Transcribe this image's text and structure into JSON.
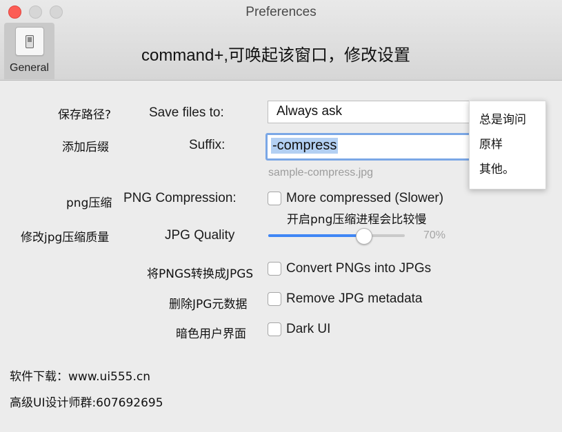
{
  "window": {
    "title": "Preferences"
  },
  "toolbar": {
    "general_tab_label": "General"
  },
  "heading": "command+,可唤起该窗口，修改设置",
  "annotations": {
    "save_path": "保存路径?",
    "suffix": "添加后缀",
    "png": "png压缩",
    "jpg_quality": "修改jpg压缩质量",
    "convert": "将PNGS转换成JPGS",
    "remove_meta": "删除JPG元数据",
    "dark_ui": "暗色用户界面",
    "png_note": "开启png压缩进程会比较慢",
    "download": "软件下载：www.ui555.cn",
    "group": "高级UI设计师群:607692695"
  },
  "form": {
    "save_label": "Save files to:",
    "save_value": "Always ask",
    "suffix_label": "Suffix:",
    "suffix_value": "-compress",
    "suffix_example": "sample-compress.jpg",
    "png_label": "PNG Compression:",
    "png_option": "More compressed (Slower)",
    "png_checked": false,
    "jpg_label": "JPG  Quality",
    "jpg_quality": 70,
    "jpg_quality_text": "70%",
    "convert_label": "Convert PNGs into JPGs",
    "convert_checked": false,
    "remove_label": "Remove JPG metadata",
    "remove_checked": false,
    "dark_label": "Dark UI",
    "dark_checked": false
  },
  "dropdown": {
    "options": [
      "总是询问",
      "原样",
      "其他。"
    ]
  },
  "colors": {
    "accent": "#3f86f5",
    "selection": "#b3d0f3",
    "close": "#fc5d55"
  }
}
